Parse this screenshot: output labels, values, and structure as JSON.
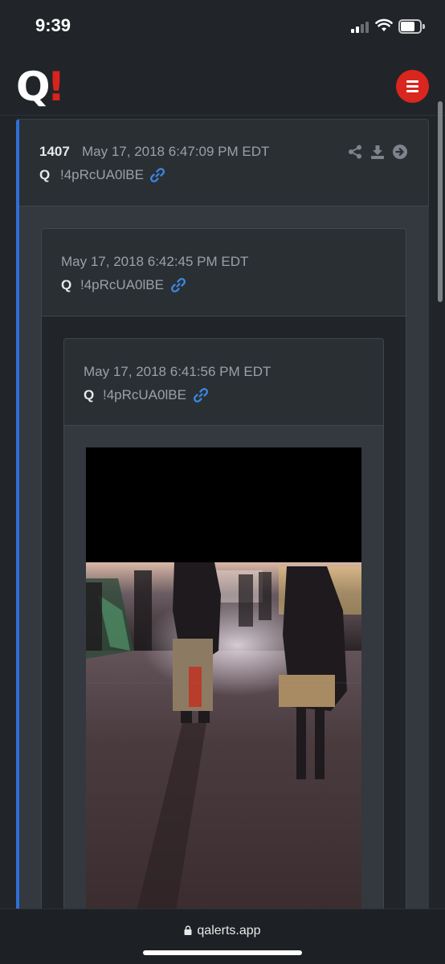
{
  "status_bar": {
    "time": "9:39",
    "signal_icon": "cellular-signal-icon",
    "wifi_icon": "wifi-icon",
    "battery_icon": "battery-icon"
  },
  "header": {
    "logo_q": "Q",
    "logo_mark": "!",
    "menu_icon": "hamburger-menu-icon",
    "colors": {
      "logo_red": "#d9241d",
      "menu_button": "#d9261e",
      "post_accent": "#2e6fd8",
      "link": "#3a86e0"
    }
  },
  "post": {
    "number": "1407",
    "date": "May 17, 2018 6:47:09 PM EDT",
    "author": "Q",
    "tripcode": "!4pRcUA0lBE",
    "link_icon": "link-icon",
    "actions": [
      "share-icon",
      "download-icon",
      "arrow-right-icon"
    ]
  },
  "quote1": {
    "date": "May 17, 2018 6:42:45 PM EDT",
    "author": "Q",
    "tripcode": "!4pRcUA0lBE"
  },
  "quote2": {
    "date": "May 17, 2018 6:41:56 PM EDT",
    "author": "Q",
    "tripcode": "!4pRcUA0lBE",
    "image": "night-street-photo"
  },
  "browser": {
    "url": "qalerts.app",
    "lock_icon": "lock-icon"
  }
}
